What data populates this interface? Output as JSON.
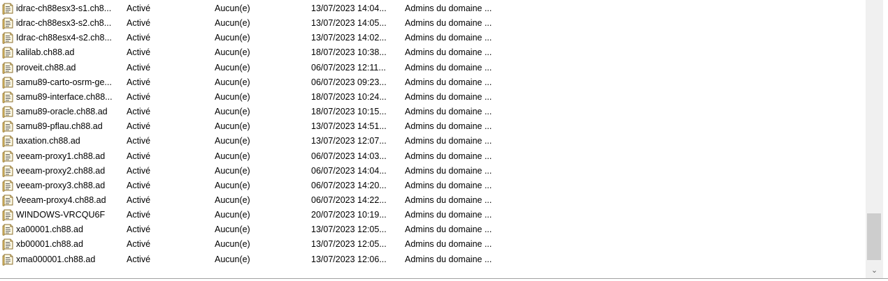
{
  "rows": [
    {
      "name": "idrac-ch88esx3-s1.ch8...",
      "state": "Activé",
      "type": "Aucun(e)",
      "date": "13/07/2023 14:04...",
      "owner": "Admins du domaine ..."
    },
    {
      "name": "idrac-ch88esx3-s2.ch8...",
      "state": "Activé",
      "type": "Aucun(e)",
      "date": "13/07/2023 14:05...",
      "owner": "Admins du domaine ..."
    },
    {
      "name": "Idrac-ch88esx4-s2.ch8...",
      "state": "Activé",
      "type": "Aucun(e)",
      "date": "13/07/2023 14:02...",
      "owner": "Admins du domaine ..."
    },
    {
      "name": "kalilab.ch88.ad",
      "state": "Activé",
      "type": "Aucun(e)",
      "date": "18/07/2023 10:38...",
      "owner": "Admins du domaine ..."
    },
    {
      "name": "proveit.ch88.ad",
      "state": "Activé",
      "type": "Aucun(e)",
      "date": "06/07/2023 12:11...",
      "owner": "Admins du domaine ..."
    },
    {
      "name": "samu89-carto-osrm-ge...",
      "state": "Activé",
      "type": "Aucun(e)",
      "date": "06/07/2023 09:23...",
      "owner": "Admins du domaine ..."
    },
    {
      "name": "samu89-interface.ch88...",
      "state": "Activé",
      "type": "Aucun(e)",
      "date": "18/07/2023 10:24...",
      "owner": "Admins du domaine ..."
    },
    {
      "name": "samu89-oracle.ch88.ad",
      "state": "Activé",
      "type": "Aucun(e)",
      "date": "18/07/2023 10:15...",
      "owner": "Admins du domaine ..."
    },
    {
      "name": "samu89-pflau.ch88.ad",
      "state": "Activé",
      "type": "Aucun(e)",
      "date": "13/07/2023 14:51...",
      "owner": "Admins du domaine ..."
    },
    {
      "name": "taxation.ch88.ad",
      "state": "Activé",
      "type": "Aucun(e)",
      "date": "13/07/2023 12:07...",
      "owner": "Admins du domaine ..."
    },
    {
      "name": "veeam-proxy1.ch88.ad",
      "state": "Activé",
      "type": "Aucun(e)",
      "date": "06/07/2023 14:03...",
      "owner": "Admins du domaine ..."
    },
    {
      "name": "veeam-proxy2.ch88.ad",
      "state": "Activé",
      "type": "Aucun(e)",
      "date": "06/07/2023 14:04...",
      "owner": "Admins du domaine ..."
    },
    {
      "name": "veeam-proxy3.ch88.ad",
      "state": "Activé",
      "type": "Aucun(e)",
      "date": "06/07/2023 14:20...",
      "owner": "Admins du domaine ..."
    },
    {
      "name": "Veeam-proxy4.ch88.ad",
      "state": "Activé",
      "type": "Aucun(e)",
      "date": "06/07/2023 14:22...",
      "owner": "Admins du domaine ..."
    },
    {
      "name": "WINDOWS-VRCQU6F",
      "state": "Activé",
      "type": "Aucun(e)",
      "date": "20/07/2023 10:19...",
      "owner": "Admins du domaine ..."
    },
    {
      "name": "xa00001.ch88.ad",
      "state": "Activé",
      "type": "Aucun(e)",
      "date": "13/07/2023 12:05...",
      "owner": "Admins du domaine ..."
    },
    {
      "name": "xb00001.ch88.ad",
      "state": "Activé",
      "type": "Aucun(e)",
      "date": "13/07/2023 12:05...",
      "owner": "Admins du domaine ..."
    },
    {
      "name": "xma000001.ch88.ad",
      "state": "Activé",
      "type": "Aucun(e)",
      "date": "13/07/2023 12:06...",
      "owner": "Admins du domaine ..."
    }
  ],
  "row_icon": "certificate-template-icon",
  "scrollbar": {
    "down_arrow": "⌄"
  }
}
